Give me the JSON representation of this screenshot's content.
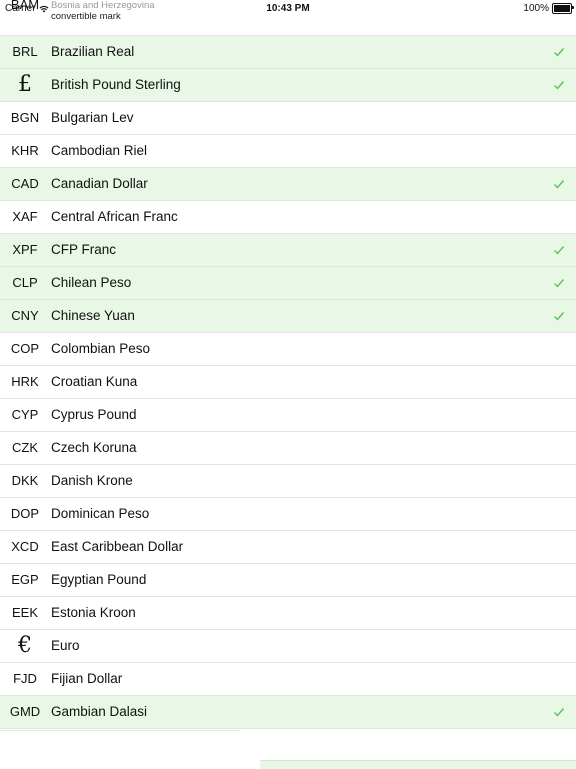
{
  "status_bar": {
    "carrier": "Carrier",
    "time": "10:43 PM",
    "battery": "100%"
  },
  "partial_row": {
    "code": "BAM",
    "name_line1": "Bosnia and Herzegovina",
    "name_line2": "convertible mark"
  },
  "currencies": [
    {
      "code": "BRL",
      "name": "Brazilian Real",
      "selected": true
    },
    {
      "code": "£",
      "name": "British Pound Sterling",
      "selected": true,
      "symbol": true
    },
    {
      "code": "BGN",
      "name": "Bulgarian Lev",
      "selected": false
    },
    {
      "code": "KHR",
      "name": "Cambodian Riel",
      "selected": false
    },
    {
      "code": "CAD",
      "name": "Canadian Dollar",
      "selected": true
    },
    {
      "code": "XAF",
      "name": "Central African Franc",
      "selected": false
    },
    {
      "code": "XPF",
      "name": "CFP Franc",
      "selected": true
    },
    {
      "code": "CLP",
      "name": "Chilean Peso",
      "selected": true
    },
    {
      "code": "CNY",
      "name": "Chinese Yuan",
      "selected": true
    },
    {
      "code": "COP",
      "name": "Colombian Peso",
      "selected": false
    },
    {
      "code": "HRK",
      "name": "Croatian Kuna",
      "selected": false
    },
    {
      "code": "CYP",
      "name": "Cyprus Pound",
      "selected": false
    },
    {
      "code": "CZK",
      "name": "Czech Koruna",
      "selected": false
    },
    {
      "code": "DKK",
      "name": "Danish Krone",
      "selected": false
    },
    {
      "code": "DOP",
      "name": "Dominican Peso",
      "selected": false
    },
    {
      "code": "XCD",
      "name": "East Caribbean Dollar",
      "selected": false
    },
    {
      "code": "EGP",
      "name": "Egyptian Pound",
      "selected": false
    },
    {
      "code": "EEK",
      "name": "Estonia Kroon",
      "selected": false
    },
    {
      "code": "€",
      "name": "Euro",
      "selected": false,
      "symbol": true
    },
    {
      "code": "FJD",
      "name": "Fijian Dollar",
      "selected": false
    },
    {
      "code": "GMD",
      "name": "Gambian Dalasi",
      "selected": true
    }
  ],
  "colors": {
    "selected_background": "#e9f7e7",
    "checkmark": "#5cc05a",
    "separator": "#e3e3e6"
  },
  "icons": {
    "checkmark": "checkmark-icon",
    "wifi": "wifi-icon",
    "battery": "battery-icon"
  }
}
